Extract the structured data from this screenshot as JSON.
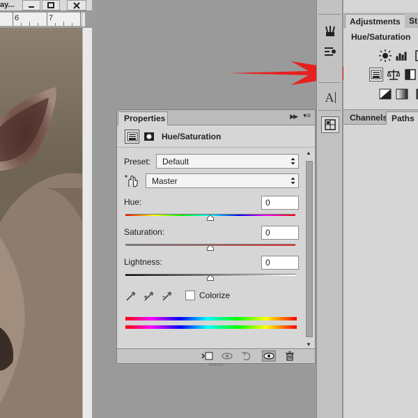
{
  "document": {
    "title": "ay...",
    "ruler_labels": [
      "6",
      "7"
    ],
    "window_buttons": {
      "minimize_icon": "minimize-icon",
      "maximize_icon": "maximize-icon",
      "close_icon": "close-icon"
    }
  },
  "toolstrip": {
    "icons": [
      "brushes-icon",
      "brush-presets-icon",
      "character-icon",
      "3d-icon"
    ],
    "character_glyph": "A"
  },
  "adjustments_panel": {
    "tabs": [
      "Adjustments",
      "St"
    ],
    "heading": "Hue/Saturation",
    "icons_row1": [
      "brightness-icon",
      "levels-icon",
      "curves-icon"
    ],
    "icons_row2": [
      "hue-saturation-icon",
      "color-balance-icon",
      "black-white-icon"
    ],
    "icons_row3": [
      "invert-icon",
      "gradient-map-icon",
      "selective-color-icon"
    ]
  },
  "channels_panel": {
    "tabs": [
      "Channels",
      "Paths"
    ]
  },
  "annotation": {
    "arrow_color": "#e82020"
  },
  "properties": {
    "tab_label": "Properties",
    "title": "Hue/Saturation",
    "preset_label": "Preset:",
    "preset_value": "Default",
    "channel_value": "Master",
    "hue": {
      "label": "Hue:",
      "value": "0",
      "level": 0.5
    },
    "saturation": {
      "label": "Saturation:",
      "value": "0",
      "level": 0.5
    },
    "lightness": {
      "label": "Lightness:",
      "value": "0",
      "level": 0.5
    },
    "colorize_label": "Colorize",
    "colorize_checked": false,
    "footer_icons": [
      "clip-to-layer-icon",
      "view-previous-icon",
      "reset-icon",
      "visibility-icon",
      "delete-icon"
    ]
  }
}
